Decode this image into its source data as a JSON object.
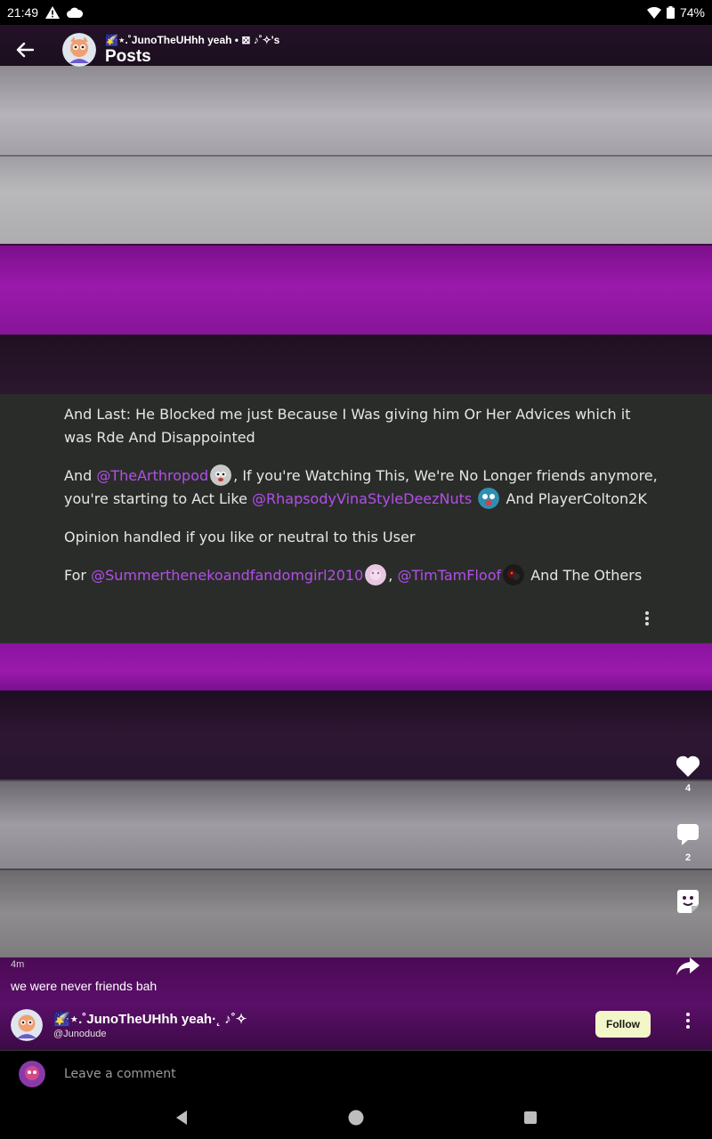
{
  "status_bar": {
    "time": "21:49",
    "battery": "74%",
    "icons": [
      "warning-icon",
      "cloud-icon",
      "wifi-icon",
      "battery-icon"
    ]
  },
  "header": {
    "subtitle": "🌠⋆.˚JunoTheUHhh yeah • ⊠ ♪˚✧'s",
    "title": "Posts"
  },
  "post": {
    "p1": "And Last: He Blocked me just Because I Was giving him Or Her Advices which it was Rde And Disappointed",
    "p2_pre": "And ",
    "p2_mention1": "@TheArthropod",
    "p2_mid": ", If you're Watching This, We're No Longer friends anymore, you're starting to Act Like ",
    "p2_mention2": "@RhapsodyVinaStyleDeezNuts",
    "p2_post": " And PlayerColton2K",
    "p3": "Opinion handled if you like or neutral to this User",
    "p4_pre": "For ",
    "p4_mention1": "@Summerthenekoandfandomgirl2010",
    "p4_sep": ", ",
    "p4_mention2": "@TimTamFloof",
    "p4_post": " And The Others"
  },
  "actions": {
    "likes": "4",
    "comments": "2"
  },
  "meta": {
    "time": "4m",
    "caption": "we were never friends bah"
  },
  "author": {
    "name": "🌠⋆.˚JunoTheUHhh yeah·˛ ♪˚✧",
    "handle": "@Junodude",
    "follow_label": "Follow"
  },
  "comment": {
    "placeholder": "Leave a comment"
  },
  "colors": {
    "accent_mention": "#b34fe8",
    "follow_bg": "#f2f6c8",
    "card_bg": "#2a2c2a"
  }
}
